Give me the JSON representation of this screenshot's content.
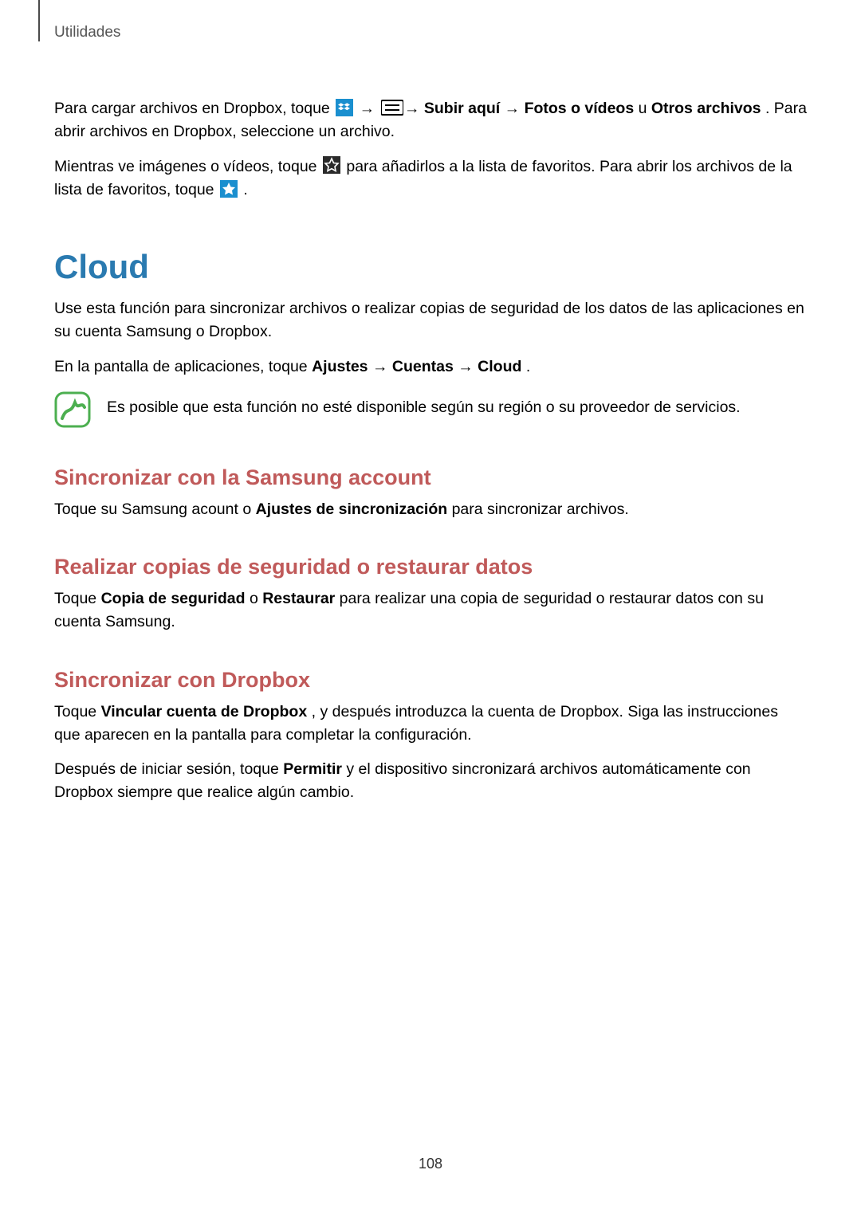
{
  "header": {
    "section_label": "Utilidades"
  },
  "dropbox_section": {
    "p1_a": "Para cargar archivos en Dropbox, toque ",
    "p1_b": " → ",
    "p1_c": " → ",
    "p1_bold_1": "Subir aquí",
    "p1_arrow": " → ",
    "p1_bold_2": "Fotos o vídeos",
    "p1_d": " u ",
    "p1_bold_3": "Otros archivos",
    "p1_e": ". Para abrir archivos en Dropbox, seleccione un archivo.",
    "p2_a": "Mientras ve imágenes o vídeos, toque ",
    "p2_b": " para añadirlos a la lista de favoritos. Para abrir los archivos de la lista de favoritos, toque ",
    "p2_c": "."
  },
  "cloud_section": {
    "title": "Cloud",
    "intro": "Use esta función para sincronizar archivos o realizar copias de seguridad de los datos de las aplicaciones en su cuenta Samsung o Dropbox.",
    "path_a": "En la pantalla de aplicaciones, toque ",
    "path_b1": "Ajustes",
    "path_arrow1": " → ",
    "path_b2": "Cuentas",
    "path_arrow2": " → ",
    "path_b3": "Cloud",
    "path_c": ".",
    "note": "Es posible que esta función no esté disponible según su región o su proveedor de servicios."
  },
  "sync_samsung": {
    "title": "Sincronizar con la Samsung account",
    "text_a": "Toque su Samsung acount o ",
    "text_b": "Ajustes de sincronización",
    "text_c": " para sincronizar archivos."
  },
  "backup": {
    "title": "Realizar copias de seguridad o restaurar datos",
    "text_a": "Toque ",
    "text_b1": "Copia de seguridad",
    "text_b": " o ",
    "text_b2": "Restaurar",
    "text_c": " para realizar una copia de seguridad o restaurar datos con su cuenta Samsung."
  },
  "sync_dropbox": {
    "title": "Sincronizar con Dropbox",
    "p1_a": "Toque ",
    "p1_b": "Vincular cuenta de Dropbox",
    "p1_c": ", y después introduzca la cuenta de Dropbox. Siga las instrucciones que aparecen en la pantalla para completar la configuración.",
    "p2_a": "Después de iniciar sesión, toque ",
    "p2_b": "Permitir",
    "p2_c": " y el dispositivo sincronizará archivos automáticamente con Dropbox siempre que realice algún cambio."
  },
  "page_number": "108"
}
